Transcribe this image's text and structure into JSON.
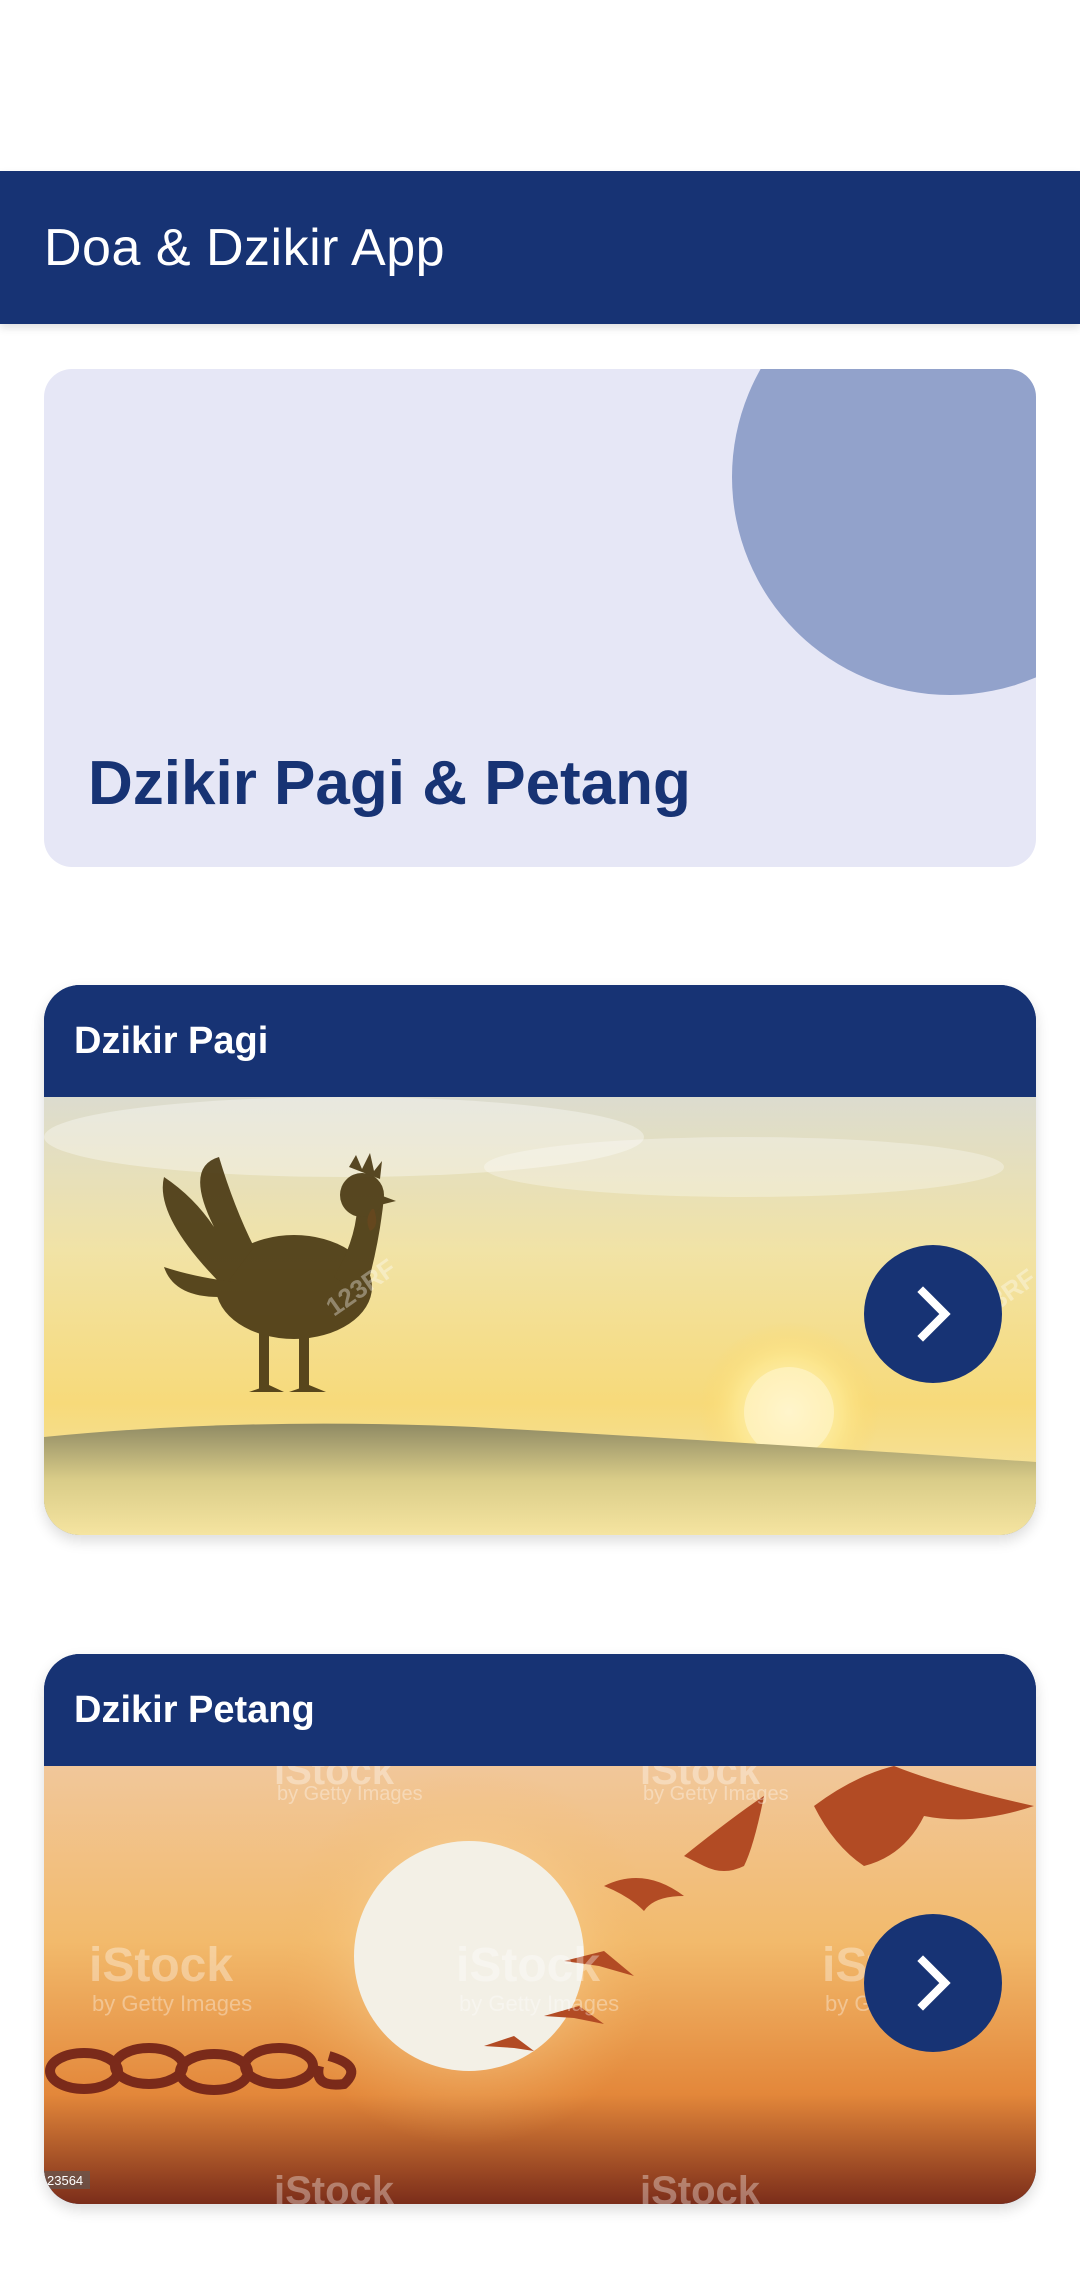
{
  "app_bar": {
    "title": "Doa & Dzikir App"
  },
  "hero": {
    "title": "Dzikir Pagi & Petang"
  },
  "cards": [
    {
      "title": "Dzikir Pagi",
      "image": "rooster-sunrise-image",
      "button_icon": "chevron-right-icon"
    },
    {
      "title": "Dzikir Petang",
      "image": "birds-sunset-image",
      "button_icon": "chevron-right-icon"
    }
  ],
  "watermarks": {
    "stock_brand": "iStock",
    "stock_sub": "by Getty Images",
    "rf_brand": "123RF",
    "stock_id": "23564"
  },
  "colors": {
    "primary": "#173374",
    "hero_background": "#e6e7f6",
    "hero_circle": "#92a2cb",
    "white": "#ffffff"
  }
}
